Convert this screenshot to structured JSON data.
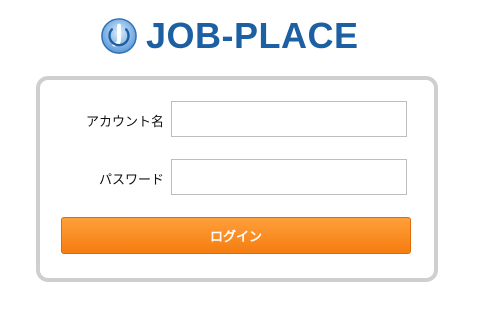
{
  "header": {
    "logo_text": "JOB-PLACE",
    "logo_icon": "power-j-icon",
    "brand_color": "#1c5fa3"
  },
  "login_form": {
    "account_label": "アカウント名",
    "account_value": "",
    "password_label": "パスワード",
    "password_value": "",
    "login_button_label": "ログイン",
    "button_color": "#f7861b",
    "panel_border_color": "#cfcfcf"
  }
}
